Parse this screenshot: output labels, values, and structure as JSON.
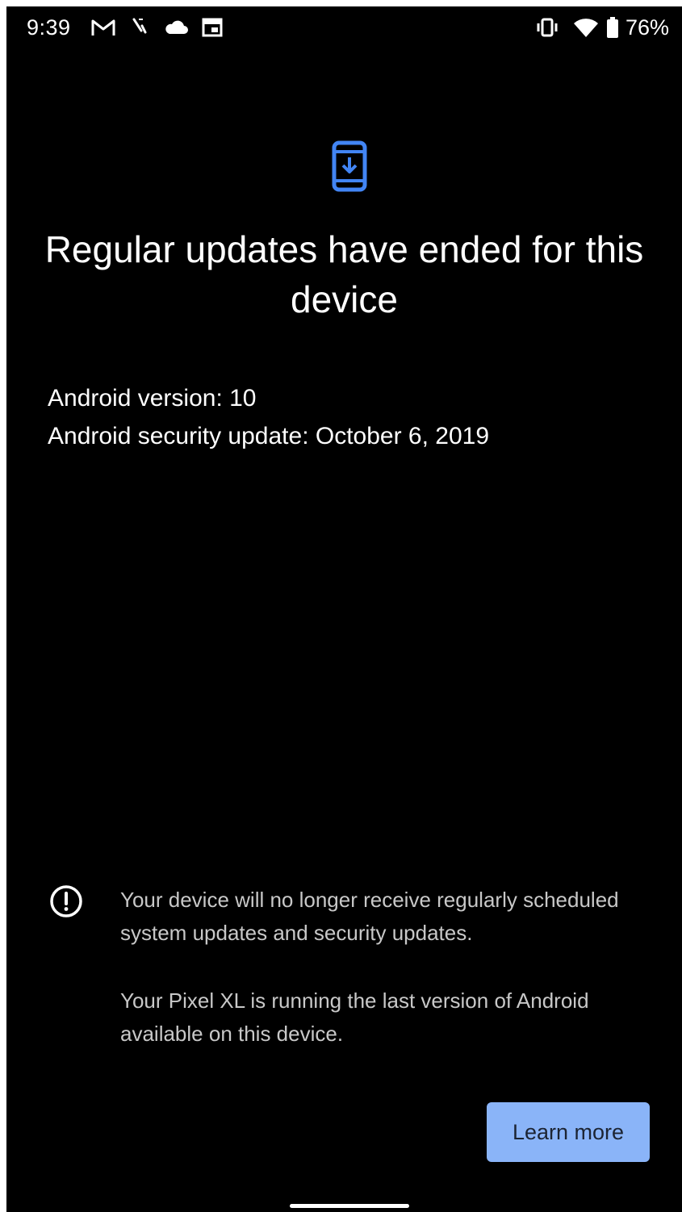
{
  "status_bar": {
    "time": "9:39",
    "battery_percent": "76%",
    "left_icons": [
      "gmail-icon",
      "missed-call-icon",
      "cloud-icon",
      "calendar-icon"
    ],
    "right_icons": [
      "vibrate-icon",
      "wifi-icon",
      "battery-icon"
    ]
  },
  "header": {
    "icon": "system-update-icon",
    "title": "Regular updates have ended for this device"
  },
  "info": {
    "android_version": "Android version: 10",
    "security_update": "Android security update: October 6, 2019"
  },
  "notice": {
    "icon": "alert-circle-icon",
    "paragraph_1": "Your device will no longer receive regularly scheduled system updates and security updates.",
    "paragraph_2": "Your Pixel XL is running the last version of Android available on this device."
  },
  "actions": {
    "learn_more_label": "Learn more"
  },
  "colors": {
    "background": "#000000",
    "accent": "#8ab4f8",
    "icon_blue": "#4285f4"
  }
}
